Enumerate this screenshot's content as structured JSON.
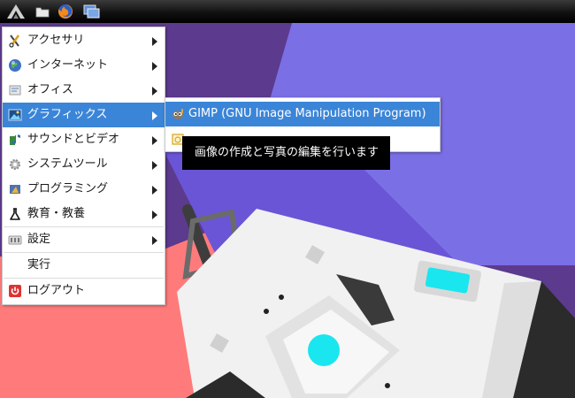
{
  "panel": {
    "buttons": [
      {
        "name": "lxde-menu-icon"
      },
      {
        "name": "file-manager-icon"
      },
      {
        "name": "firefox-icon"
      },
      {
        "name": "show-desktop-icon"
      }
    ]
  },
  "main_menu": {
    "items": [
      {
        "label": "アクセサリ",
        "icon": "accessories-icon",
        "submenu": true
      },
      {
        "label": "インターネット",
        "icon": "internet-globe-icon",
        "submenu": true
      },
      {
        "label": "オフィス",
        "icon": "office-icon",
        "submenu": true
      },
      {
        "label": "グラフィックス",
        "icon": "graphics-icon",
        "submenu": true,
        "selected": true
      },
      {
        "label": "サウンドとビデオ",
        "icon": "sound-video-icon",
        "submenu": true
      },
      {
        "label": "システムツール",
        "icon": "system-tools-icon",
        "submenu": true
      },
      {
        "label": "プログラミング",
        "icon": "programming-icon",
        "submenu": true
      },
      {
        "label": "教育・教養",
        "icon": "education-flask-icon",
        "submenu": true
      },
      {
        "label": "設定",
        "icon": "settings-icon",
        "submenu": true
      },
      {
        "label": "実行",
        "icon": "",
        "submenu": false
      },
      {
        "label": "ログアウト",
        "icon": "logout-icon",
        "submenu": false
      }
    ]
  },
  "sub_menu": {
    "items": [
      {
        "label": "GIMP (GNU Image Manipulation Program)",
        "icon": "gimp-icon",
        "selected": true
      },
      {
        "label": "",
        "icon": "image-viewer-icon",
        "selected": false
      }
    ]
  },
  "tooltip": {
    "text": "画像の作成と写真の編集を行います"
  },
  "colors": {
    "selection": "#3b85d8",
    "panel": "#111111",
    "wallpaper_purple": "#5c3a8e",
    "wallpaper_salmon": "#ff7b7b",
    "wallpaper_lavender": "#7b6fe6",
    "accent_cyan": "#19e6ef"
  }
}
